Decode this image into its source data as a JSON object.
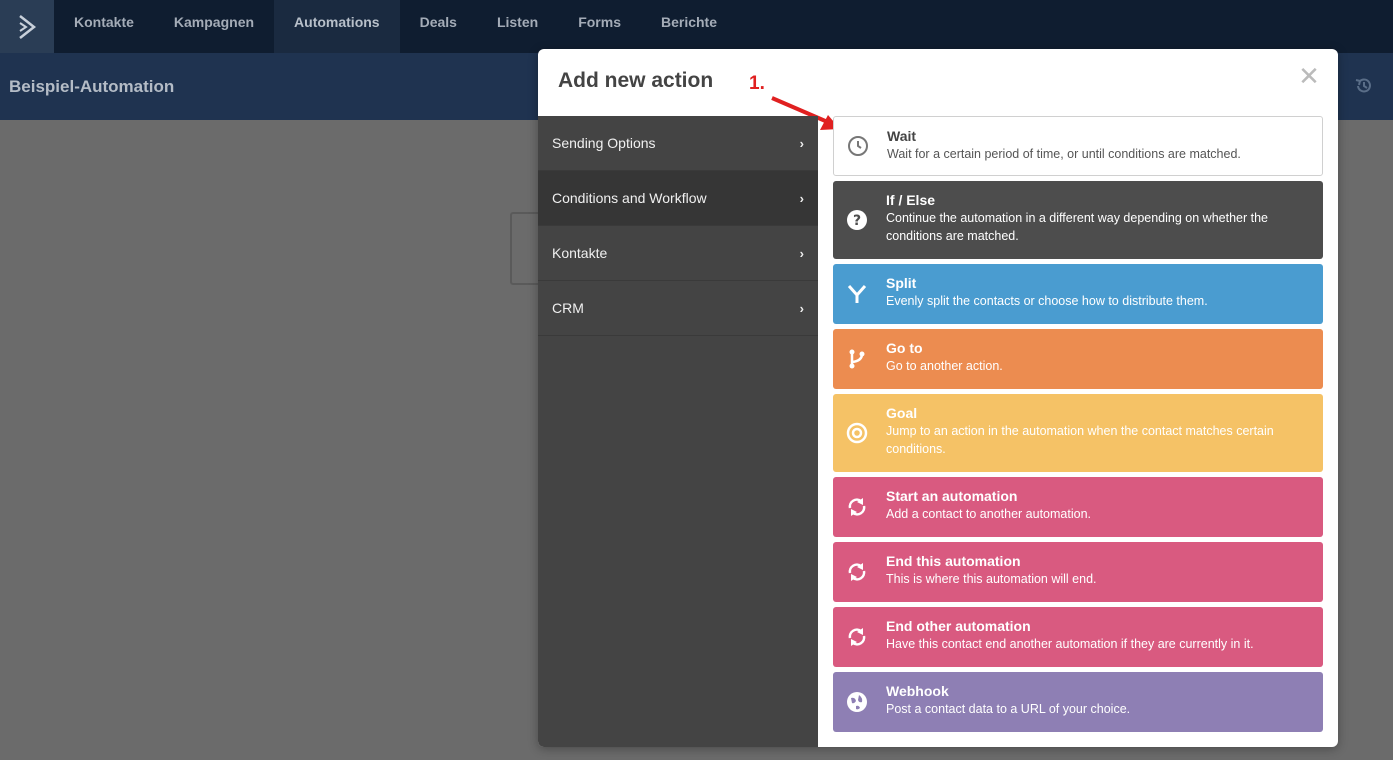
{
  "nav": {
    "items": [
      {
        "label": "Kontakte"
      },
      {
        "label": "Kampagnen"
      },
      {
        "label": "Automations"
      },
      {
        "label": "Deals"
      },
      {
        "label": "Listen"
      },
      {
        "label": "Forms"
      },
      {
        "label": "Berichte"
      }
    ],
    "active": "Automations"
  },
  "page": {
    "title": "Beispiel-Automation"
  },
  "modal": {
    "title": "Add new action",
    "close_label": "✕",
    "annotation": "1.",
    "sidebar": [
      {
        "label": "Sending Options"
      },
      {
        "label": "Conditions and Workflow"
      },
      {
        "label": "Kontakte"
      },
      {
        "label": "CRM"
      }
    ],
    "actions": [
      {
        "title": "Wait",
        "desc": "Wait for a certain period of time, or until conditions are matched.",
        "icon": "clock-icon"
      },
      {
        "title": "If / Else",
        "desc": "Continue the automation in a different way depending on whether the conditions are matched.",
        "icon": "question-icon"
      },
      {
        "title": "Split",
        "desc": "Evenly split the contacts or choose how to distribute them.",
        "icon": "split-icon"
      },
      {
        "title": "Go to",
        "desc": "Go to another action.",
        "icon": "branch-icon"
      },
      {
        "title": "Goal",
        "desc": "Jump to an action in the automation when the contact matches certain conditions.",
        "icon": "target-icon"
      },
      {
        "title": "Start an automation",
        "desc": "Add a contact to another automation.",
        "icon": "sync-icon"
      },
      {
        "title": "End this automation",
        "desc": "This is where this automation will end.",
        "icon": "sync-icon"
      },
      {
        "title": "End other automation",
        "desc": "Have this contact end another automation if they are currently in it.",
        "icon": "sync-icon"
      },
      {
        "title": "Webhook",
        "desc": "Post a contact data to a URL of your choice.",
        "icon": "globe-icon"
      }
    ]
  },
  "colors": {
    "nav_bg": "#0f1d30",
    "subheader_bg": "#1f3350",
    "if_else": "#4d4d4d",
    "split": "#4a9cd0",
    "goto": "#ec8c50",
    "goal": "#f5c266",
    "automation": "#d95a80",
    "webhook": "#8e7fb4",
    "annotation": "#e02020"
  }
}
